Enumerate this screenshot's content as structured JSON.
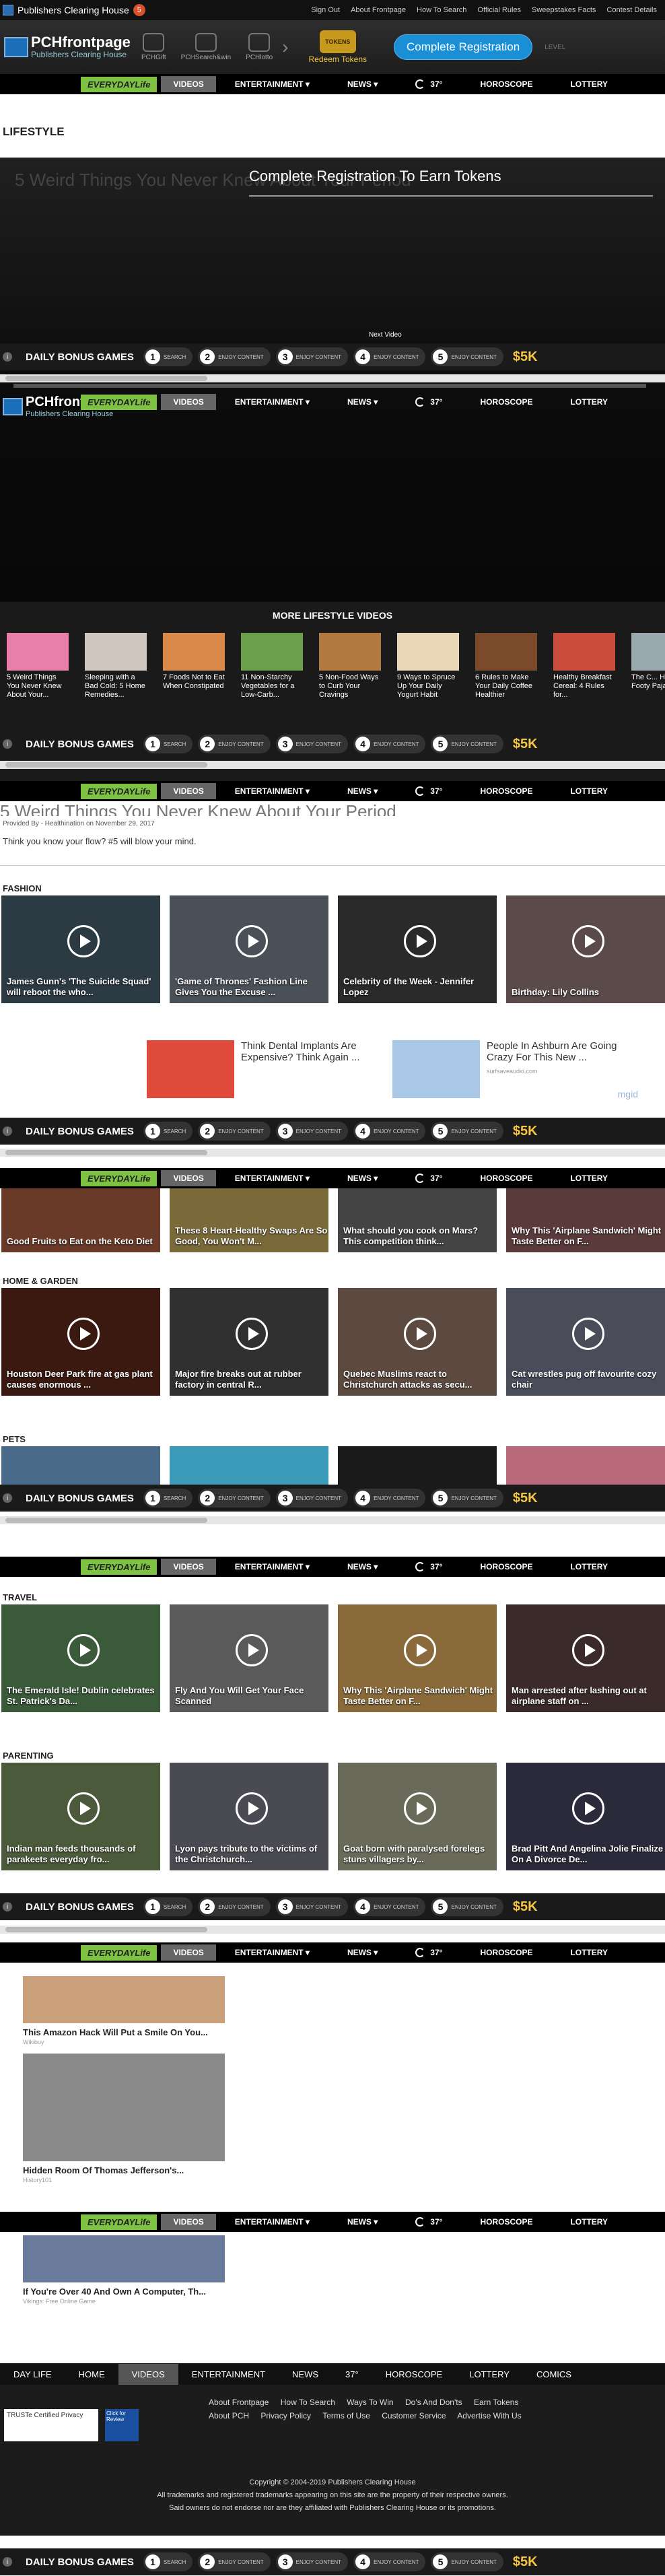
{
  "topbar": {
    "brand": "Publishers Clearing House",
    "links": [
      "Sign Out",
      "About Frontpage",
      "How To Search",
      "Official Rules",
      "Sweepstakes Facts",
      "Contest Details"
    ]
  },
  "header": {
    "logo_main": "PCHfrontpage",
    "logo_sub": "Publishers Clearing House",
    "icons": [
      "PCHGift",
      "PCHSearch&win",
      "PCHlotto"
    ],
    "tokens_label": "Redeem Tokens",
    "coin_text": "TOKENS",
    "register_button": "Complete Registration",
    "right_text": "LEVEL"
  },
  "nav": {
    "everyday_life": "EVERYDAYLife",
    "new_badge": "New",
    "videos": "VIDEOS",
    "items": [
      "ENTERTAINMENT ▾",
      "NEWS ▾"
    ],
    "weather": "37°",
    "horoscope": "HOROSCOPE",
    "lottery": "LOTTERY"
  },
  "lifestyle_heading": "LIFESTYLE",
  "player": {
    "video_title": "5 Weird Things You Never Knew About Your Period",
    "cta": "Complete Registration To Earn Tokens",
    "next": "Next Video"
  },
  "bonus": {
    "label": "DAILY BONUS GAMES",
    "slot1": "SEARCH",
    "slot_other": "ENJOY CONTENT",
    "amount": "$5K"
  },
  "more": {
    "title": "MORE LIFESTYLE VIDEOS",
    "items": [
      "5 Weird Things You Never Knew About Your...",
      "Sleeping with a Bad Cold: 5 Home Remedies...",
      "7 Foods Not to Eat When Constipated",
      "11 Non-Starchy Vegetables for a Low-Carb...",
      "5 Non-Food Ways to Curb Your Cravings",
      "9 Ways to Spruce Up Your Daily Yogurt Habit",
      "6 Rules to Make Your Daily Coffee Healthier",
      "Healthy Breakfast Cereal: 4 Rules for...",
      "The C... Histo... Footy Paja..."
    ]
  },
  "article": {
    "title": "5 Weird Things You Never Knew About Your Period",
    "meta": "Provided By - Healthination on November 29, 2017",
    "dek": "Think you know your flow? #5 will blow your mind."
  },
  "sections": {
    "fashion": {
      "title": "FASHION",
      "cards": [
        "James Gunn's 'The Suicide Squad' will reboot the who...",
        "'Game of Thrones' Fashion Line Gives You the Excuse ...",
        "Celebrity of the Week - Jennifer Lopez",
        "Birthday: Lily Collins"
      ]
    },
    "food": {
      "cards": [
        "Good Fruits to Eat on the Keto Diet",
        "These 8 Heart-Healthy Swaps Are So Good, You Won't M...",
        "What should you cook on Mars? This competition think...",
        "Why This 'Airplane Sandwich' Might Taste Better on F..."
      ]
    },
    "home": {
      "title": "HOME & GARDEN",
      "cards": [
        "Houston Deer Park fire at gas plant causes enormous ...",
        "Major fire breaks out at rubber factory in central R...",
        "Quebec Muslims react to Christchurch attacks as secu...",
        "Cat wrestles pug off favourite cozy chair"
      ]
    },
    "pets": {
      "title": "PETS"
    },
    "travel": {
      "title": "TRAVEL",
      "cards": [
        "The Emerald Isle! Dublin celebrates St. Patrick's Da...",
        "Fly And You Will Get Your Face Scanned",
        "Why This 'Airplane Sandwich' Might Taste Better on F...",
        "Man arrested after lashing out at airplane staff on ..."
      ]
    },
    "parenting": {
      "title": "PARENTING",
      "cards": [
        "Indian man feeds thousands of parakeets everyday fro...",
        "Lyon pays tribute to the victims of the Christchurch...",
        "Goat born with paralysed forelegs stuns villagers by...",
        "Brad Pitt And Angelina Jolie Finalize On A Divorce De..."
      ]
    }
  },
  "ads": [
    {
      "text": "Think Dental Implants Are Expensive? Think Again ...",
      "source": ""
    },
    {
      "text": "People In Ashburn Are Going Crazy For This New ...",
      "source": "surfsaveaudio.com"
    }
  ],
  "ads_brand": "mgid",
  "recommended": [
    {
      "title": "This Amazon Hack Will Put a Smile On You...",
      "source": "Wikibuy"
    },
    {
      "title": "Hidden Room Of Thomas Jefferson's...",
      "source": "History101"
    },
    {
      "title": "If You're Over 40 And Own A Computer, Th...",
      "source": "Vikings: Free Online Game"
    }
  ],
  "footer_nav": [
    "DAY LIFE",
    "HOME",
    "VIDEOS",
    "ENTERTAINMENT",
    "NEWS",
    "37°",
    "HOROSCOPE",
    "LOTTERY",
    "COMICS"
  ],
  "footer": {
    "row1": [
      "About Frontpage",
      "How To Search",
      "Ways To Win",
      "Do's And Don'ts",
      "Earn Tokens"
    ],
    "row2": [
      "About PCH",
      "Privacy Policy",
      "Terms of Use",
      "Customer Service",
      "Advertise With Us"
    ],
    "trust": "TRUSTe Certified Privacy",
    "bbb": "Click for Review",
    "copyright": "Copyright © 2004-2019 Publishers Clearing House",
    "trademark1": "All trademarks and registered trademarks appearing on this site are the property of their respective owners.",
    "trademark2": "Said owners do not endorse nor are they affiliated with Publishers Clearing House or its promotions."
  },
  "colors": {
    "accent_blue": "#1a8fd6",
    "everyday_green": "#7ec242",
    "gold": "#f5c542"
  }
}
